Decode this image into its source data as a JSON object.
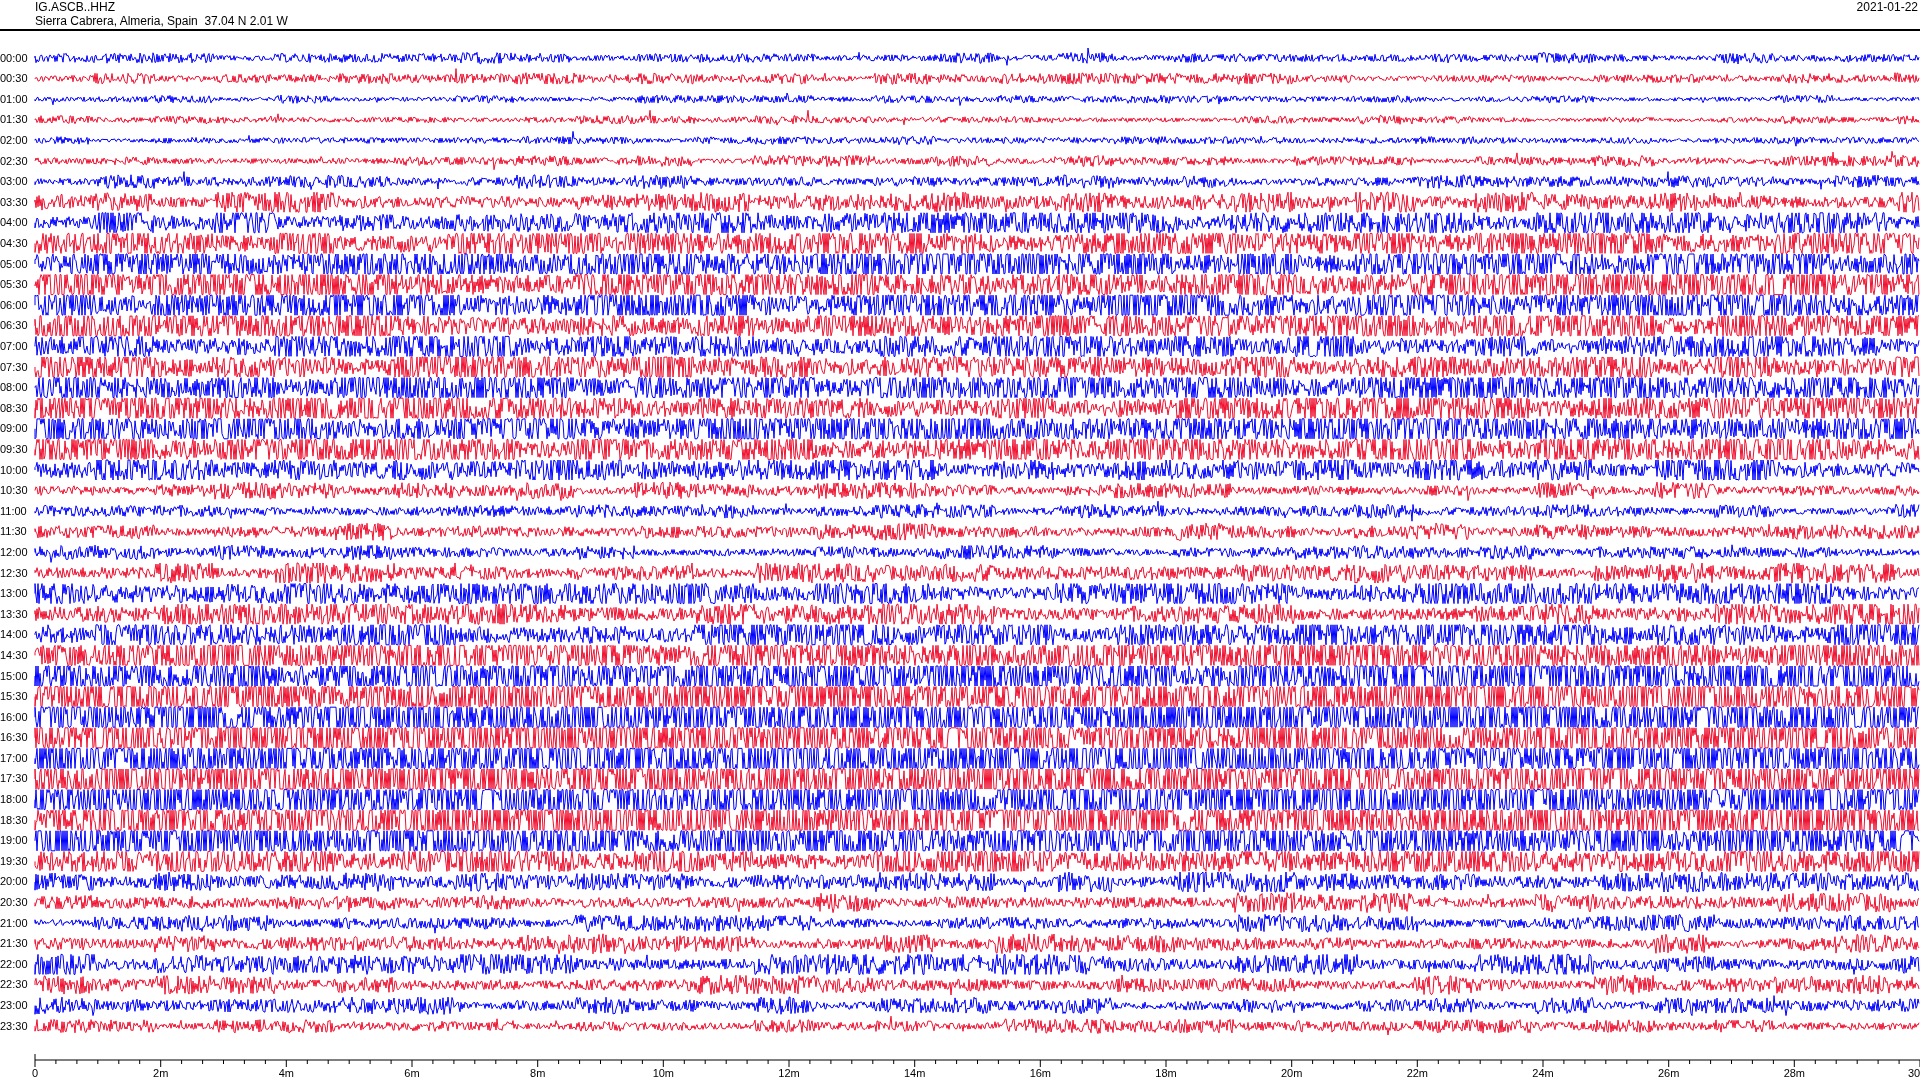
{
  "header": {
    "station": "IG.ASCB..HHZ",
    "location": "Sierra Cabrera, Almeria, Spain  37.04 N 2.01 W",
    "date": "2021-01-22"
  },
  "traces": [
    {
      "label": "00:00",
      "color": "#0000ff"
    },
    {
      "label": "00:30",
      "color": "#f0102f"
    },
    {
      "label": "01:00",
      "color": "#0000ff"
    },
    {
      "label": "01:30",
      "color": "#f0102f"
    },
    {
      "label": "02:00",
      "color": "#0000ff"
    },
    {
      "label": "02:30",
      "color": "#f0102f"
    },
    {
      "label": "03:00",
      "color": "#0000ff"
    },
    {
      "label": "03:30",
      "color": "#f0102f"
    },
    {
      "label": "04:00",
      "color": "#0000ff"
    },
    {
      "label": "04:30",
      "color": "#f0102f"
    },
    {
      "label": "05:00",
      "color": "#0000ff"
    },
    {
      "label": "05:30",
      "color": "#f0102f"
    },
    {
      "label": "06:00",
      "color": "#0000ff"
    },
    {
      "label": "06:30",
      "color": "#f0102f"
    },
    {
      "label": "07:00",
      "color": "#0000ff"
    },
    {
      "label": "07:30",
      "color": "#f0102f"
    },
    {
      "label": "08:00",
      "color": "#0000ff"
    },
    {
      "label": "08:30",
      "color": "#f0102f"
    },
    {
      "label": "09:00",
      "color": "#0000ff"
    },
    {
      "label": "09:30",
      "color": "#f0102f"
    },
    {
      "label": "10:00",
      "color": "#0000ff"
    },
    {
      "label": "10:30",
      "color": "#f0102f"
    },
    {
      "label": "11:00",
      "color": "#0000ff"
    },
    {
      "label": "11:30",
      "color": "#f0102f"
    },
    {
      "label": "12:00",
      "color": "#0000ff"
    },
    {
      "label": "12:30",
      "color": "#f0102f"
    },
    {
      "label": "13:00",
      "color": "#0000ff"
    },
    {
      "label": "13:30",
      "color": "#f0102f"
    },
    {
      "label": "14:00",
      "color": "#0000ff"
    },
    {
      "label": "14:30",
      "color": "#f0102f"
    },
    {
      "label": "15:00",
      "color": "#0000ff"
    },
    {
      "label": "15:30",
      "color": "#f0102f"
    },
    {
      "label": "16:00",
      "color": "#0000ff"
    },
    {
      "label": "16:30",
      "color": "#f0102f"
    },
    {
      "label": "17:00",
      "color": "#0000ff"
    },
    {
      "label": "17:30",
      "color": "#f0102f"
    },
    {
      "label": "18:00",
      "color": "#0000ff"
    },
    {
      "label": "18:30",
      "color": "#f0102f"
    },
    {
      "label": "19:00",
      "color": "#0000ff"
    },
    {
      "label": "19:30",
      "color": "#f0102f"
    },
    {
      "label": "20:00",
      "color": "#0000ff"
    },
    {
      "label": "20:30",
      "color": "#f0102f"
    },
    {
      "label": "21:00",
      "color": "#0000ff"
    },
    {
      "label": "21:30",
      "color": "#f0102f"
    },
    {
      "label": "22:00",
      "color": "#0000ff"
    },
    {
      "label": "22:30",
      "color": "#f0102f"
    },
    {
      "label": "23:00",
      "color": "#0000ff"
    },
    {
      "label": "23:30",
      "color": "#f0102f"
    }
  ],
  "x_axis": {
    "labels": [
      "0",
      "2m",
      "4m",
      "6m",
      "8m",
      "10m",
      "12m",
      "14m",
      "16m",
      "18m",
      "20m",
      "22m",
      "24m",
      "26m",
      "28m",
      "30"
    ]
  }
}
